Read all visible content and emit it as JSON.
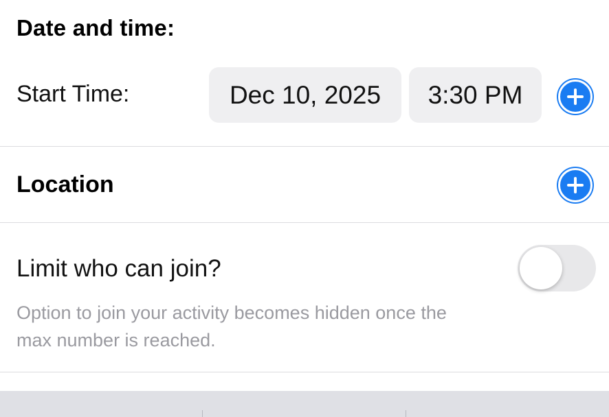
{
  "date_time": {
    "header": "Date and time:",
    "start_label": "Start Time:",
    "date_value": "Dec 10, 2025",
    "time_value": "3:30 PM"
  },
  "location": {
    "label": "Location"
  },
  "limit": {
    "label": "Limit who can join?",
    "hint": "Option to join your activity becomes hidden once the max number is reached.",
    "toggle_on": false
  },
  "colors": {
    "accent": "#1a7cf2",
    "pill_bg": "#efeff1",
    "hint_text": "#9a9aa0"
  },
  "icons": {
    "add": "plus-circle-icon"
  }
}
